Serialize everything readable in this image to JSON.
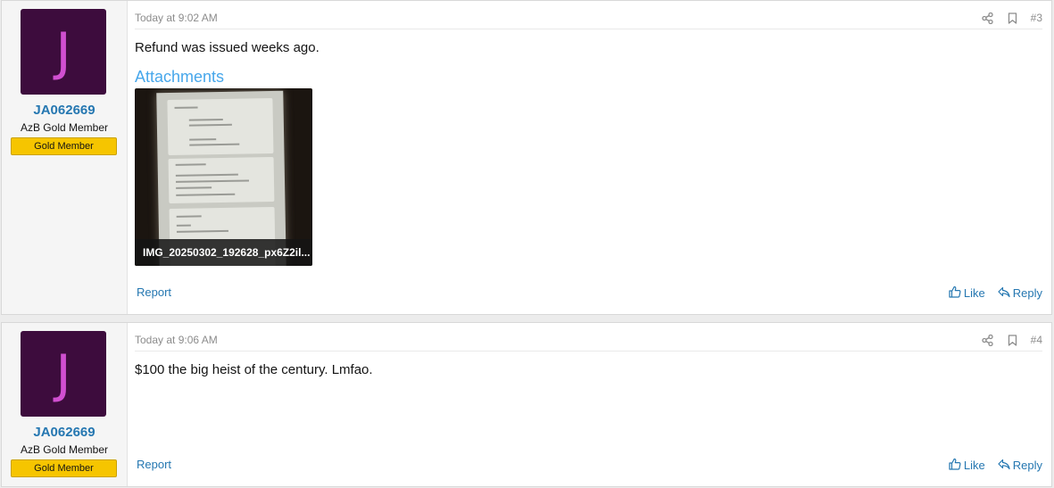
{
  "posts": [
    {
      "avatar_letter": "J",
      "username": "JA062669",
      "user_title": "AzB Gold Member",
      "badge": "Gold Member",
      "time": "Today at 9:02 AM",
      "post_number": "#3",
      "text": "Refund was issued weeks ago.",
      "attachments_title": "Attachments",
      "attachment_caption": "IMG_20250302_192628_px6Z2il...",
      "report_label": "Report",
      "like_label": "Like",
      "reply_label": "Reply"
    },
    {
      "avatar_letter": "J",
      "username": "JA062669",
      "user_title": "AzB Gold Member",
      "badge": "Gold Member",
      "time": "Today at 9:06 AM",
      "post_number": "#4",
      "text": "$100 the big heist of the century. Lmfao.",
      "report_label": "Report",
      "like_label": "Like",
      "reply_label": "Reply"
    }
  ],
  "icons": {
    "share": "share-icon",
    "bookmark": "bookmark-icon",
    "like": "thumbs-up-icon",
    "reply": "reply-icon"
  },
  "colors": {
    "avatar_bg": "#3d0c3d",
    "avatar_letter": "#d04fd0",
    "link": "#2577b1",
    "badge": "#f6c500",
    "attachments_title": "#47a7eb"
  }
}
